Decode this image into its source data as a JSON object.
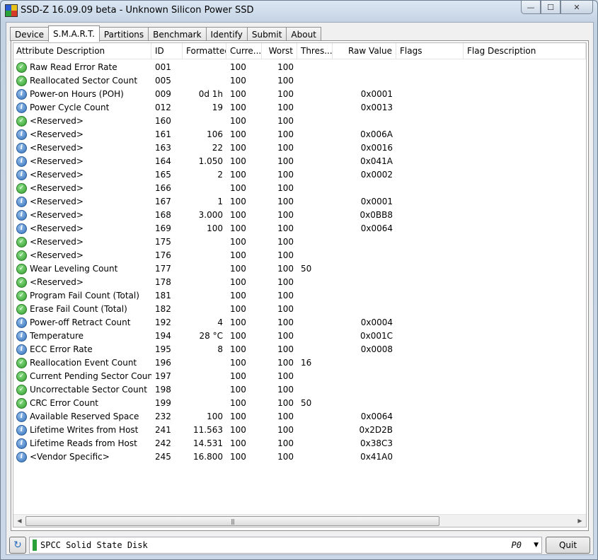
{
  "window": {
    "title": "SSD-Z 16.09.09 beta - Unknown Silicon Power SSD"
  },
  "caption": {
    "minimize": "—",
    "maximize": "☐",
    "close": "✕"
  },
  "tabs": [
    "Device",
    "S.M.A.R.T.",
    "Partitions",
    "Benchmark",
    "Identify",
    "Submit",
    "About"
  ],
  "active_tab": "S.M.A.R.T.",
  "columns": [
    "Attribute Description",
    "ID",
    "Formatted",
    "Curre...",
    "Worst",
    "Thres...",
    "Raw Value",
    "Flags",
    "Flag Description"
  ],
  "rows": [
    {
      "icon": "ok",
      "desc": "Raw Read Error Rate",
      "id": "001",
      "formatted": "",
      "current": "100",
      "worst": "100",
      "threshold": "",
      "raw": "",
      "flags": "",
      "flag_desc": ""
    },
    {
      "icon": "ok",
      "desc": "Reallocated Sector Count",
      "id": "005",
      "formatted": "",
      "current": "100",
      "worst": "100",
      "threshold": "",
      "raw": "",
      "flags": "",
      "flag_desc": ""
    },
    {
      "icon": "info",
      "desc": "Power-on Hours (POH)",
      "id": "009",
      "formatted": "0d 1h",
      "current": "100",
      "worst": "100",
      "threshold": "",
      "raw": "0x0001",
      "flags": "",
      "flag_desc": ""
    },
    {
      "icon": "info",
      "desc": "Power Cycle Count",
      "id": "012",
      "formatted": "19",
      "current": "100",
      "worst": "100",
      "threshold": "",
      "raw": "0x0013",
      "flags": "",
      "flag_desc": ""
    },
    {
      "icon": "ok",
      "desc": "<Reserved>",
      "id": "160",
      "formatted": "",
      "current": "100",
      "worst": "100",
      "threshold": "",
      "raw": "",
      "flags": "",
      "flag_desc": ""
    },
    {
      "icon": "info",
      "desc": "<Reserved>",
      "id": "161",
      "formatted": "106",
      "current": "100",
      "worst": "100",
      "threshold": "",
      "raw": "0x006A",
      "flags": "",
      "flag_desc": ""
    },
    {
      "icon": "info",
      "desc": "<Reserved>",
      "id": "163",
      "formatted": "22",
      "current": "100",
      "worst": "100",
      "threshold": "",
      "raw": "0x0016",
      "flags": "",
      "flag_desc": ""
    },
    {
      "icon": "info",
      "desc": "<Reserved>",
      "id": "164",
      "formatted": "1.050",
      "current": "100",
      "worst": "100",
      "threshold": "",
      "raw": "0x041A",
      "flags": "",
      "flag_desc": ""
    },
    {
      "icon": "info",
      "desc": "<Reserved>",
      "id": "165",
      "formatted": "2",
      "current": "100",
      "worst": "100",
      "threshold": "",
      "raw": "0x0002",
      "flags": "",
      "flag_desc": ""
    },
    {
      "icon": "ok",
      "desc": "<Reserved>",
      "id": "166",
      "formatted": "",
      "current": "100",
      "worst": "100",
      "threshold": "",
      "raw": "",
      "flags": "",
      "flag_desc": ""
    },
    {
      "icon": "info",
      "desc": "<Reserved>",
      "id": "167",
      "formatted": "1",
      "current": "100",
      "worst": "100",
      "threshold": "",
      "raw": "0x0001",
      "flags": "",
      "flag_desc": ""
    },
    {
      "icon": "info",
      "desc": "<Reserved>",
      "id": "168",
      "formatted": "3.000",
      "current": "100",
      "worst": "100",
      "threshold": "",
      "raw": "0x0BB8",
      "flags": "",
      "flag_desc": ""
    },
    {
      "icon": "info",
      "desc": "<Reserved>",
      "id": "169",
      "formatted": "100",
      "current": "100",
      "worst": "100",
      "threshold": "",
      "raw": "0x0064",
      "flags": "",
      "flag_desc": ""
    },
    {
      "icon": "ok",
      "desc": "<Reserved>",
      "id": "175",
      "formatted": "",
      "current": "100",
      "worst": "100",
      "threshold": "",
      "raw": "",
      "flags": "",
      "flag_desc": ""
    },
    {
      "icon": "ok",
      "desc": "<Reserved>",
      "id": "176",
      "formatted": "",
      "current": "100",
      "worst": "100",
      "threshold": "",
      "raw": "",
      "flags": "",
      "flag_desc": ""
    },
    {
      "icon": "ok",
      "desc": "Wear Leveling Count",
      "id": "177",
      "formatted": "",
      "current": "100",
      "worst": "100",
      "threshold": "50",
      "raw": "",
      "flags": "",
      "flag_desc": ""
    },
    {
      "icon": "ok",
      "desc": "<Reserved>",
      "id": "178",
      "formatted": "",
      "current": "100",
      "worst": "100",
      "threshold": "",
      "raw": "",
      "flags": "",
      "flag_desc": ""
    },
    {
      "icon": "ok",
      "desc": "Program Fail Count (Total)",
      "id": "181",
      "formatted": "",
      "current": "100",
      "worst": "100",
      "threshold": "",
      "raw": "",
      "flags": "",
      "flag_desc": ""
    },
    {
      "icon": "ok",
      "desc": "Erase Fail Count (Total)",
      "id": "182",
      "formatted": "",
      "current": "100",
      "worst": "100",
      "threshold": "",
      "raw": "",
      "flags": "",
      "flag_desc": ""
    },
    {
      "icon": "info",
      "desc": "Power-off Retract Count",
      "id": "192",
      "formatted": "4",
      "current": "100",
      "worst": "100",
      "threshold": "",
      "raw": "0x0004",
      "flags": "",
      "flag_desc": ""
    },
    {
      "icon": "info",
      "desc": "Temperature",
      "id": "194",
      "formatted": "28 °C",
      "current": "100",
      "worst": "100",
      "threshold": "",
      "raw": "0x001C",
      "flags": "",
      "flag_desc": ""
    },
    {
      "icon": "info",
      "desc": "ECC Error Rate",
      "id": "195",
      "formatted": "8",
      "current": "100",
      "worst": "100",
      "threshold": "",
      "raw": "0x0008",
      "flags": "",
      "flag_desc": ""
    },
    {
      "icon": "ok",
      "desc": "Reallocation Event Count",
      "id": "196",
      "formatted": "",
      "current": "100",
      "worst": "100",
      "threshold": "16",
      "raw": "",
      "flags": "",
      "flag_desc": ""
    },
    {
      "icon": "ok",
      "desc": "Current Pending Sector Count",
      "id": "197",
      "formatted": "",
      "current": "100",
      "worst": "100",
      "threshold": "",
      "raw": "",
      "flags": "",
      "flag_desc": ""
    },
    {
      "icon": "ok",
      "desc": "Uncorrectable Sector Count",
      "id": "198",
      "formatted": "",
      "current": "100",
      "worst": "100",
      "threshold": "",
      "raw": "",
      "flags": "",
      "flag_desc": ""
    },
    {
      "icon": "ok",
      "desc": "CRC Error Count",
      "id": "199",
      "formatted": "",
      "current": "100",
      "worst": "100",
      "threshold": "50",
      "raw": "",
      "flags": "",
      "flag_desc": ""
    },
    {
      "icon": "info",
      "desc": "Available Reserved Space",
      "id": "232",
      "formatted": "100",
      "current": "100",
      "worst": "100",
      "threshold": "",
      "raw": "0x0064",
      "flags": "",
      "flag_desc": ""
    },
    {
      "icon": "info",
      "desc": "Lifetime Writes from Host",
      "id": "241",
      "formatted": "11.563",
      "current": "100",
      "worst": "100",
      "threshold": "",
      "raw": "0x2D2B",
      "flags": "",
      "flag_desc": ""
    },
    {
      "icon": "info",
      "desc": "Lifetime Reads from Host",
      "id": "242",
      "formatted": "14.531",
      "current": "100",
      "worst": "100",
      "threshold": "",
      "raw": "0x38C3",
      "flags": "",
      "flag_desc": ""
    },
    {
      "icon": "info",
      "desc": "<Vendor Specific>",
      "id": "245",
      "formatted": "16.800",
      "current": "100",
      "worst": "100",
      "threshold": "",
      "raw": "0x41A0",
      "flags": "",
      "flag_desc": ""
    }
  ],
  "scrollbar": {
    "left_arrow": "◀",
    "right_arrow": "▶",
    "grip": "|||"
  },
  "footer": {
    "drive_name": "SPCC Solid State Disk",
    "partition": "P0",
    "dropdown_arrow": "▼",
    "refresh_icon": "↻",
    "quit_label": "Quit"
  },
  "colors": {
    "ok_icon": "#2f9a2a",
    "info_icon": "#2f6db8",
    "drive_indicator": "#2ba13a"
  }
}
